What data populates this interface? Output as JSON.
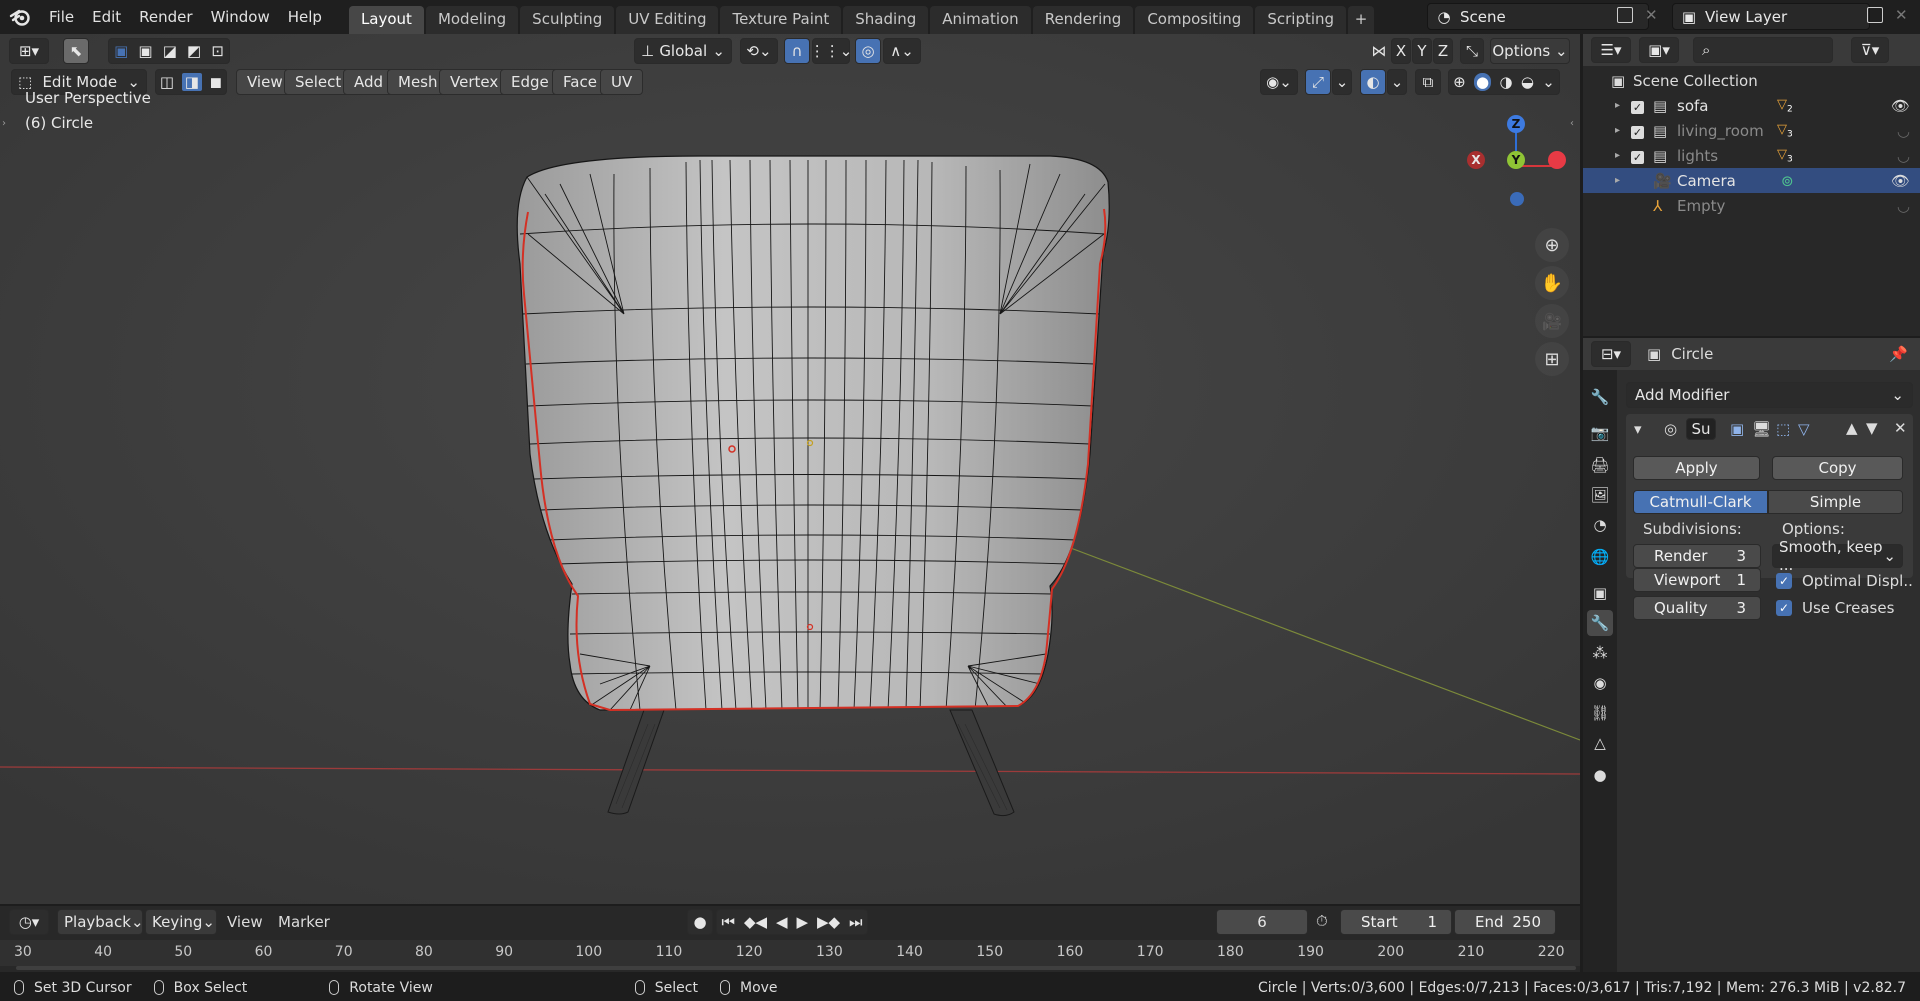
{
  "menus": [
    "File",
    "Edit",
    "Render",
    "Window",
    "Help"
  ],
  "workspace_tabs": [
    "Layout",
    "Modeling",
    "Sculpting",
    "UV Editing",
    "Texture Paint",
    "Shading",
    "Animation",
    "Rendering",
    "Compositing",
    "Scripting"
  ],
  "active_workspace": "Layout",
  "scene": {
    "name": "Scene",
    "view_layer": "View Layer"
  },
  "viewport": {
    "mode": "Edit Mode",
    "menus": [
      "View",
      "Select",
      "Add",
      "Mesh",
      "Vertex",
      "Edge",
      "Face",
      "UV"
    ],
    "transform_orientation": "Global",
    "options_label": "Options",
    "axis_labels": [
      "X",
      "Y",
      "Z"
    ],
    "overlay_view": "User Perspective",
    "overlay_object": "(6) Circle",
    "gizmo": {
      "x": "X",
      "y": "Y",
      "z": "Z"
    },
    "colors": {
      "background": "#3d3d3d",
      "x_axis": "#a33a3a",
      "y_axis": "#8fb33a",
      "edge_select": "#d63a2a"
    }
  },
  "outliner": {
    "root": "Scene Collection",
    "items": [
      {
        "name": "sofa",
        "checked": true,
        "badge": "2",
        "dim": false,
        "selected": false,
        "icon": "collection-icon"
      },
      {
        "name": "living_room",
        "checked": true,
        "badge": "3",
        "dim": true,
        "selected": false,
        "icon": "collection-icon"
      },
      {
        "name": "lights",
        "checked": true,
        "badge": "3",
        "dim": true,
        "selected": false,
        "icon": "collection-icon"
      },
      {
        "name": "Camera",
        "checked": false,
        "badge": "",
        "dim": false,
        "selected": true,
        "icon": "camera-icon"
      },
      {
        "name": "Empty",
        "checked": false,
        "badge": "",
        "dim": true,
        "selected": false,
        "icon": "empty-icon"
      }
    ]
  },
  "properties": {
    "object_name": "Circle",
    "add_modifier": "Add Modifier",
    "modifier_name": "Su",
    "apply": "Apply",
    "copy": "Copy",
    "subdiv_types": [
      "Catmull-Clark",
      "Simple"
    ],
    "active_type": "Catmull-Clark",
    "subdivisions_label": "Subdivisions:",
    "options_label": "Options:",
    "render_label": "Render",
    "render_value": "3",
    "viewport_label": "Viewport",
    "viewport_value": "1",
    "quality_label": "Quality",
    "quality_value": "3",
    "uv_smooth": "Smooth, keep ...",
    "optimal_display": "Optimal Displ..",
    "use_creases": "Use Creases"
  },
  "timeline": {
    "menus": [
      "Playback",
      "Keying",
      "View",
      "Marker"
    ],
    "current_frame": "6",
    "start_label": "Start",
    "start": "1",
    "end_label": "End",
    "end": "250",
    "ruler": [
      "30",
      "40",
      "50",
      "60",
      "70",
      "80",
      "90",
      "100",
      "110",
      "120",
      "130",
      "140",
      "150",
      "160",
      "170",
      "180",
      "190",
      "200",
      "210",
      "220"
    ]
  },
  "statusbar": {
    "hints": [
      "Set 3D Cursor",
      "Box Select",
      "Rotate View",
      "Select",
      "Move"
    ],
    "stats": "Circle | Verts:0/3,600 | Edges:0/7,213 | Faces:0/3,617 | Tris:7,192 | Mem: 276.3 MiB | v2.82.7"
  }
}
